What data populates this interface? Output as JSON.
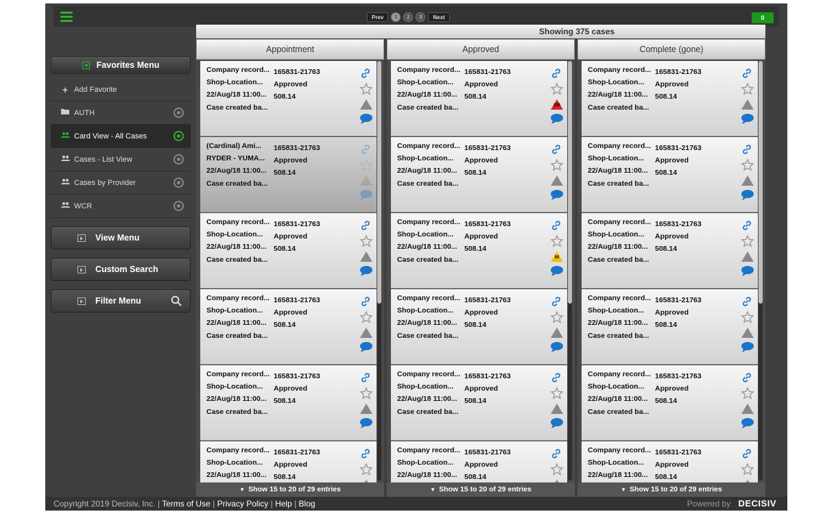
{
  "topbar": {
    "pager": {
      "prev": "Prev",
      "pages": [
        "1",
        "2",
        "3"
      ],
      "next": "Next"
    },
    "badge": "0"
  },
  "sidebar": {
    "favorites_title": "Favorites Menu",
    "items": [
      {
        "label": "Add Favorite",
        "icon": "plus-icon"
      },
      {
        "label": "AUTH",
        "icon": "folder-icon"
      },
      {
        "label": "Card View - All Cases",
        "icon": "users-icon"
      },
      {
        "label": "Cases - List View",
        "icon": "users-icon"
      },
      {
        "label": "Cases by Provider",
        "icon": "users-icon"
      },
      {
        "label": "WCR",
        "icon": "users-icon"
      }
    ],
    "view_menu": "View Menu",
    "custom_search": "Custom Search",
    "filter_menu": "Filter Menu"
  },
  "main": {
    "showing": "Showing 375 cases",
    "columns": [
      {
        "title": "Appointment",
        "footer": "Show 15 to 20 of 29 entries",
        "cards": [
          {
            "a1": "Company record...",
            "a2": "165831-21763",
            "b1": "Shop-Location...",
            "b2": "Approved",
            "c1": "22/Aug/18 11:00...",
            "c2": "508.14",
            "d1": "Case created ba...",
            "alert": ""
          },
          {
            "a1": "(Cardinal) Ami...",
            "a2": "165831-21763",
            "b1": "RYDER - YUMA...",
            "b2": "Approved",
            "c1": "22/Aug/18 11:00...",
            "c2": "508.14",
            "d1": "Case created ba...",
            "alert": ""
          },
          {
            "a1": "Company record...",
            "a2": "165831-21763",
            "b1": "Shop-Location...",
            "b2": "Approved",
            "c1": "22/Aug/18 11:00...",
            "c2": "508.14",
            "d1": "Case created ba...",
            "alert": ""
          },
          {
            "a1": "Company record...",
            "a2": "165831-21763",
            "b1": "Shop-Location...",
            "b2": "Approved",
            "c1": "22/Aug/18 11:00...",
            "c2": "508.14",
            "d1": "Case created ba...",
            "alert": ""
          },
          {
            "a1": "Company record...",
            "a2": "165831-21763",
            "b1": "Shop-Location...",
            "b2": "Approved",
            "c1": "22/Aug/18 11:00...",
            "c2": "508.14",
            "d1": "Case created ba...",
            "alert": ""
          },
          {
            "a1": "Company record...",
            "a2": "165831-21763",
            "b1": "Shop-Location...",
            "b2": "Approved",
            "c1": "22/Aug/18 11:00...",
            "c2": "508.14",
            "d1": "",
            "alert": ""
          }
        ]
      },
      {
        "title": "Approved",
        "footer": "Show 15 to 20 of 29 entries",
        "cards": [
          {
            "a1": "Company record...",
            "a2": "165831-21763",
            "b1": "Shop-Location...",
            "b2": "Approved",
            "c1": "22/Aug/18 11:00...",
            "c2": "508.14",
            "d1": "Case created ba...",
            "alert": "100"
          },
          {
            "a1": "Company record...",
            "a2": "165831-21763",
            "b1": "Shop-Location...",
            "b2": "Approved",
            "c1": "22/Aug/18 11:00...",
            "c2": "508.14",
            "d1": "Case created ba...",
            "alert": ""
          },
          {
            "a1": "Company record...",
            "a2": "165831-21763",
            "b1": "Shop-Location...",
            "b2": "Approved",
            "c1": "22/Aug/18 11:00...",
            "c2": "508.14",
            "d1": "Case created ba...",
            "alert": "50"
          },
          {
            "a1": "Company record...",
            "a2": "165831-21763",
            "b1": "Shop-Location...",
            "b2": "Approved",
            "c1": "22/Aug/18 11:00...",
            "c2": "508.14",
            "d1": "Case created ba...",
            "alert": ""
          },
          {
            "a1": "Company record...",
            "a2": "165831-21763",
            "b1": "Shop-Location...",
            "b2": "Approved",
            "c1": "22/Aug/18 11:00...",
            "c2": "508.14",
            "d1": "Case created ba...",
            "alert": ""
          },
          {
            "a1": "Company record...",
            "a2": "165831-21763",
            "b1": "Shop-Location...",
            "b2": "Approved",
            "c1": "22/Aug/18 11:00...",
            "c2": "508.14",
            "d1": "",
            "alert": ""
          }
        ]
      },
      {
        "title": "Complete (gone)",
        "footer": "Show 15 to 20 of 29 entries",
        "cards": [
          {
            "a1": "Company record...",
            "a2": "165831-21763",
            "b1": "Shop-Location...",
            "b2": "Approved",
            "c1": "22/Aug/18 11:00...",
            "c2": "508.14",
            "d1": "Case created ba...",
            "alert": ""
          },
          {
            "a1": "Company record...",
            "a2": "165831-21763",
            "b1": "Shop-Location...",
            "b2": "Approved",
            "c1": "22/Aug/18 11:00...",
            "c2": "508.14",
            "d1": "Case created ba...",
            "alert": ""
          },
          {
            "a1": "Company record...",
            "a2": "165831-21763",
            "b1": "Shop-Location...",
            "b2": "Approved",
            "c1": "22/Aug/18 11:00...",
            "c2": "508.14",
            "d1": "Case created ba...",
            "alert": ""
          },
          {
            "a1": "Company record...",
            "a2": "165831-21763",
            "b1": "Shop-Location...",
            "b2": "Approved",
            "c1": "22/Aug/18 11:00...",
            "c2": "508.14",
            "d1": "Case created ba...",
            "alert": ""
          },
          {
            "a1": "Company record...",
            "a2": "165831-21763",
            "b1": "Shop-Location...",
            "b2": "Approved",
            "c1": "22/Aug/18 11:00...",
            "c2": "508.14",
            "d1": "Case created ba...",
            "alert": ""
          },
          {
            "a1": "Company record...",
            "a2": "165831-21763",
            "b1": "Shop-Location...",
            "b2": "Approved",
            "c1": "22/Aug/18 11:00...",
            "c2": "508.14",
            "d1": "",
            "alert": ""
          }
        ]
      }
    ]
  },
  "footer": {
    "copyright": "Copyright 2019 Decisiv, Inc. |",
    "links": [
      "Terms of Use",
      "Privacy Policy",
      "Help",
      "Blog"
    ],
    "powered_by": "Powered by",
    "brand": "DECISIV"
  },
  "colors": {
    "accent_green": "#30b030",
    "alert_red": "#e02020",
    "alert_yellow": "#f0c000",
    "link_blue": "#1a74c8"
  }
}
